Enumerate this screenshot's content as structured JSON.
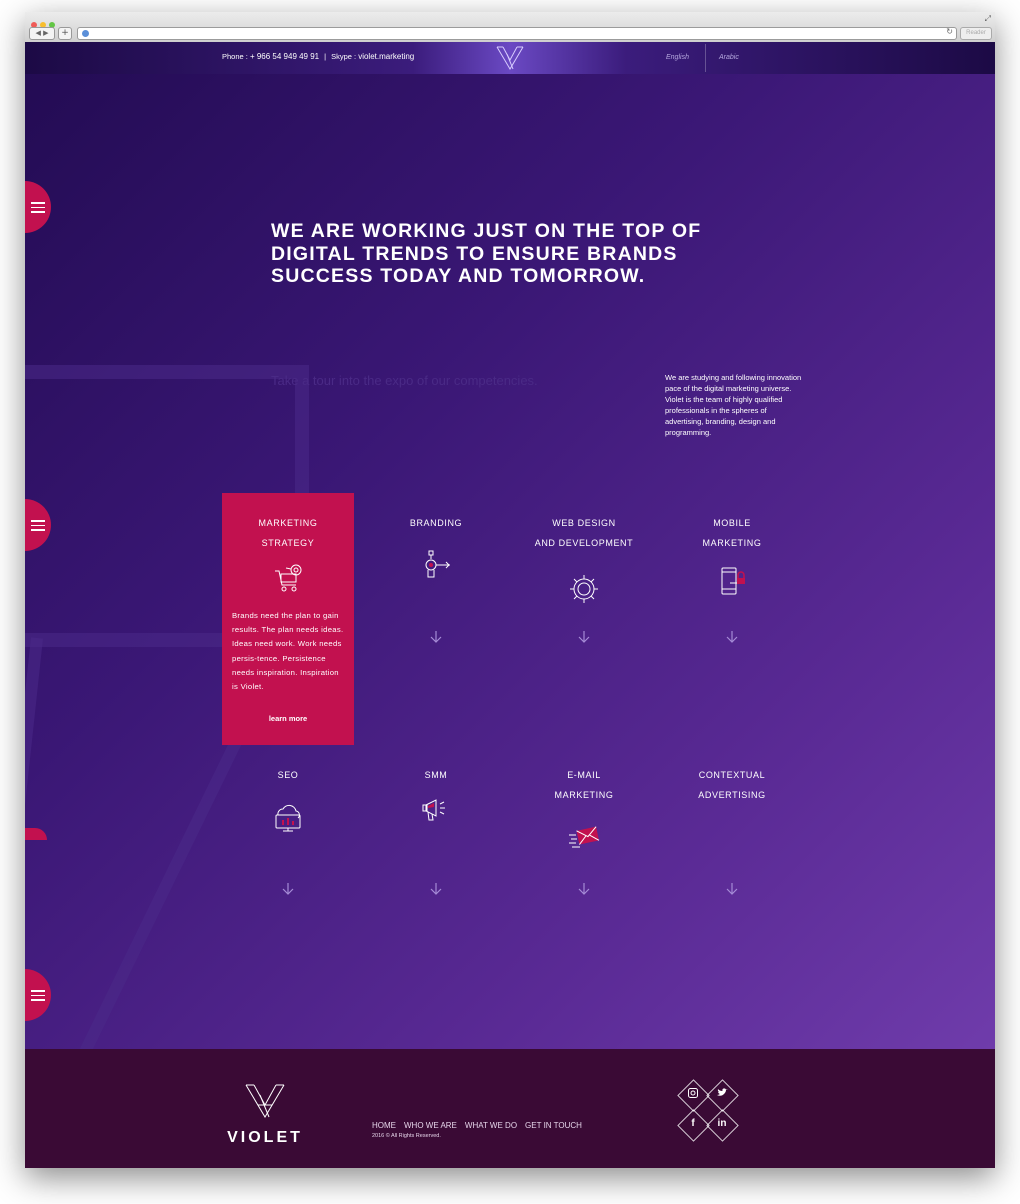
{
  "browser": {
    "reader_label": "Reader"
  },
  "topbar": {
    "phone_label": "Phone : ",
    "phone_value": "+ 966 54 949 49 91",
    "divider": "|",
    "skype_label": "Skype : ",
    "skype_value": "violet.marketing",
    "languages": [
      "English",
      "Arabic"
    ]
  },
  "hero": {
    "headline_lines": [
      "WE ARE WORKING JUST ON THE TOP OF",
      "DIGITAL TRENDS TO ENSURE BRANDS",
      "SUCCESS TODAY AND TOMORROW."
    ],
    "tour_text": "Take a tour into the expo of our competencies.",
    "intro": "We are studying and following innovation pace of the digital marketing universe. Violet is the team of highly qualified professionals in the spheres of advertising, branding, design and programming."
  },
  "services": [
    {
      "title_lines": [
        "MARKETING",
        "STRATEGY"
      ],
      "icon": "shopping-cart-icon",
      "active": true,
      "description": "Brands need the plan to gain results. The plan needs ideas. Ideas need work. Work needs persis-tence. Persistence needs inspiration. Inspiration is Violet.",
      "link": "learn more"
    },
    {
      "title_lines": [
        "BRANDING"
      ],
      "icon": "target-icon"
    },
    {
      "title_lines": [
        "WEB DESIGN",
        "AND DEVELOPMENT"
      ],
      "icon": "gear-icon"
    },
    {
      "title_lines": [
        "MOBILE",
        "MARKETING"
      ],
      "icon": "mobile-icon"
    },
    {
      "title_lines": [
        "SEO"
      ],
      "icon": "cloud-monitor-icon"
    },
    {
      "title_lines": [
        "SMM"
      ],
      "icon": "megaphone-icon"
    },
    {
      "title_lines": [
        "E-MAIL",
        "MARKETING"
      ],
      "icon": "envelope-icon"
    },
    {
      "title_lines": [
        "CONTEXTUAL",
        "ADVERTISING"
      ],
      "icon": "none"
    }
  ],
  "footer": {
    "wordmark": "VIOLET",
    "nav": [
      "HOME",
      "WHO WE ARE",
      "WHAT WE DO",
      "GET IN TOUCH"
    ],
    "copyright": "2016 © All Rights Reserved.",
    "social": [
      {
        "name": "instagram",
        "glyph": "◘"
      },
      {
        "name": "twitter",
        "glyph": "🐦"
      },
      {
        "name": "facebook",
        "glyph": "f"
      },
      {
        "name": "linkedin",
        "glyph": "in"
      }
    ]
  },
  "colors": {
    "accent": "#c2114f",
    "footer_bg": "#3a0a35",
    "bg_dark": "#220b52",
    "bg_light": "#7440b0"
  }
}
